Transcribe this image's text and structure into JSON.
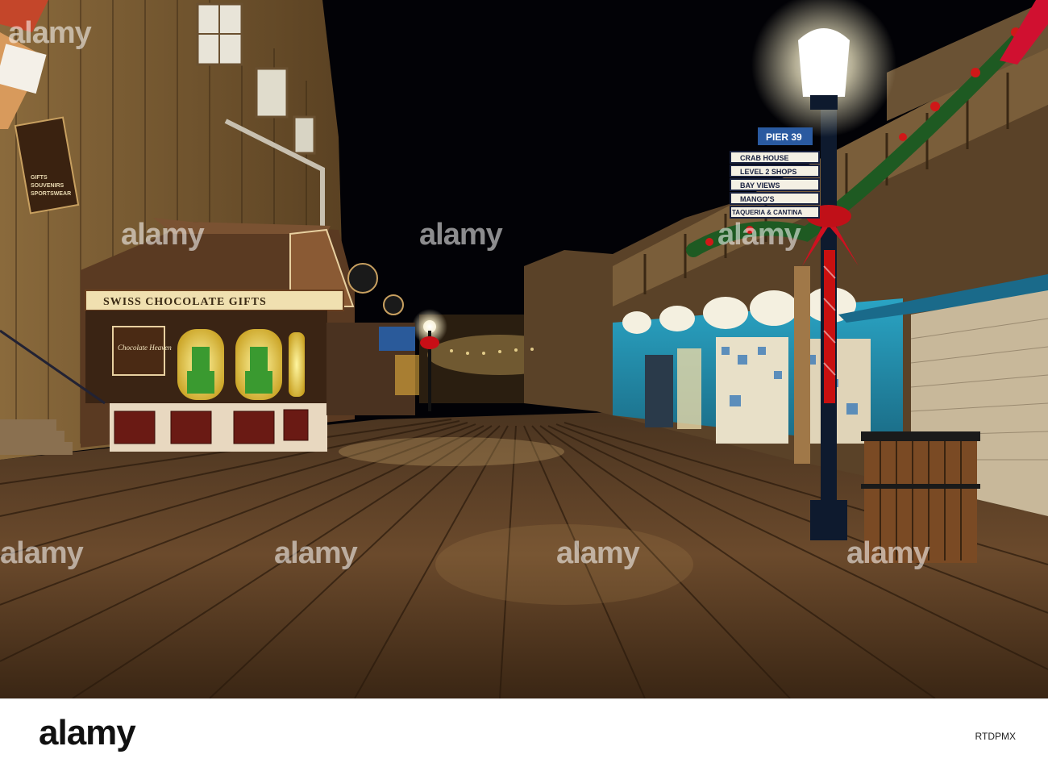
{
  "scene": {
    "description_tags": [
      "pier",
      "boardwalk",
      "night"
    ]
  },
  "storefront": {
    "main_sign": "SWISS CHOCOLATE GIFTS",
    "window_plaque": "Chocolate Heaven"
  },
  "left_building_sign": {
    "line1": "GIFTS",
    "line2": "SOUVENIRS",
    "line3": "SPORTSWEAR"
  },
  "directional_sign": {
    "top": "PIER 39",
    "items": [
      "CRAB HOUSE",
      "LEVEL 2 SHOPS",
      "BAY VIEWS",
      "MANGO'S",
      "TAQUERIA & CANTINA"
    ]
  },
  "watermark": {
    "text": "alamy"
  },
  "footer": {
    "logo": "alamy",
    "image_id": "RTDPMX"
  },
  "colors": {
    "sky": "#020206",
    "boardwalk": "#6b4a2c",
    "shop_teal": "#1f8aa6",
    "shop_glow": "#f2d55a",
    "garland": "#1e5a22",
    "bow": "#c8101c"
  }
}
